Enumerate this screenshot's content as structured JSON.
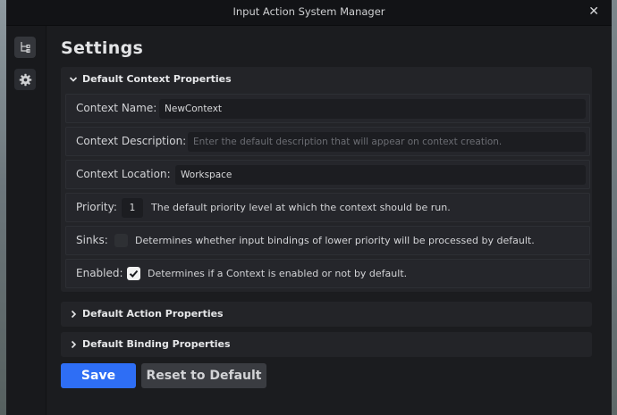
{
  "window": {
    "title": "Input Action System Manager"
  },
  "sidebar": {
    "items": [
      {
        "icon": "hierarchy-icon",
        "selected": true
      },
      {
        "icon": "gear-icon",
        "selected": false
      }
    ]
  },
  "page": {
    "title": "Settings"
  },
  "sections": {
    "context": {
      "title": "Default Context Properties",
      "expanded": true,
      "name": {
        "label": "Context Name:",
        "value": "NewContext"
      },
      "description": {
        "label": "Context Description:",
        "value": "",
        "placeholder": "Enter the default description that will appear on context creation."
      },
      "location": {
        "label": "Context Location:",
        "value": "Workspace"
      },
      "priority": {
        "label": "Priority:",
        "value": "1",
        "description": "The default priority level at which the context should be run."
      },
      "sinks": {
        "label": "Sinks:",
        "checked": false,
        "description": "Determines whether input bindings of lower priority will be processed by default."
      },
      "enabled": {
        "label": "Enabled:",
        "checked": true,
        "description": "Determines if a Context is enabled or not by default."
      }
    },
    "action": {
      "title": "Default Action Properties",
      "expanded": false
    },
    "binding": {
      "title": "Default Binding Properties",
      "expanded": false
    }
  },
  "actions": {
    "save": "Save",
    "reset": "Reset to Default"
  },
  "colors": {
    "accent": "#2e6ef5",
    "panel": "#232428",
    "background": "#1b1c1f"
  }
}
